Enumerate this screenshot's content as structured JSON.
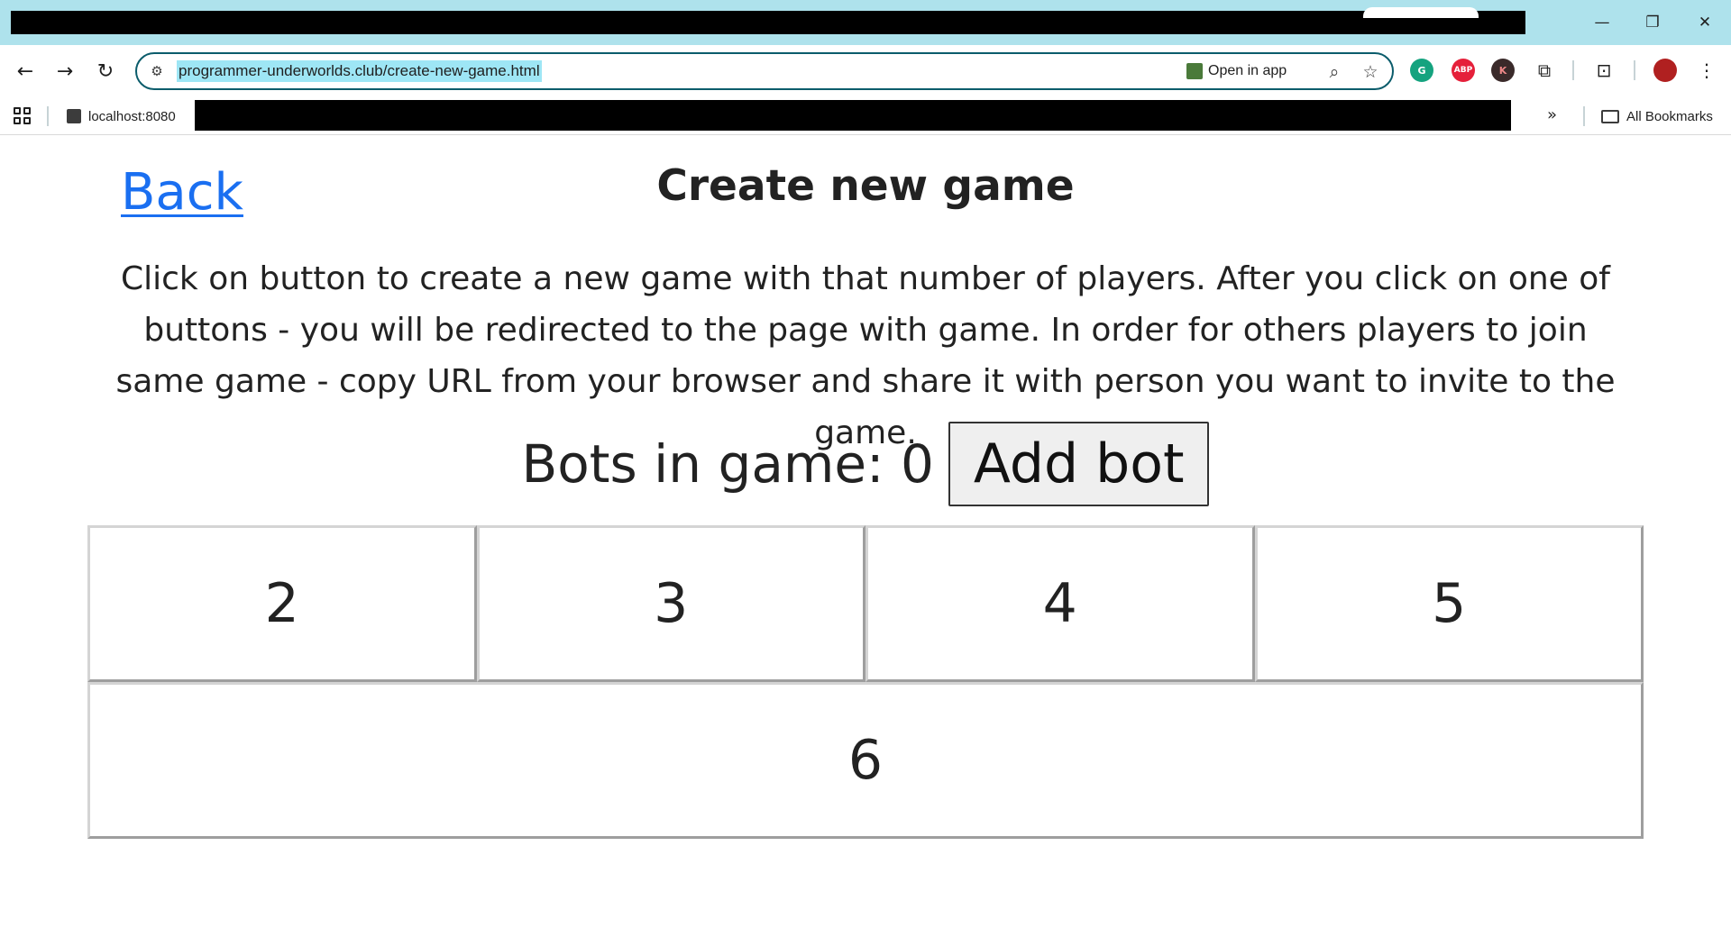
{
  "browser": {
    "url": "programmer-underworlds.club/create-new-game.html",
    "open_in_app": "Open in app",
    "window_minimize": "—",
    "window_restore": "❐",
    "window_close": "✕",
    "nav_back": "←",
    "nav_forward": "→",
    "nav_reload": "↻",
    "zoom_icon": "⌕",
    "star_icon": "☆",
    "ext_grammarly": "G",
    "ext_abp": "ABP",
    "ext_k": "K",
    "bookmarks": {
      "localhost": "localhost:8080",
      "more": "»",
      "all": "All Bookmarks"
    }
  },
  "page": {
    "back_label": "Back",
    "title": "Create new game",
    "instructions": "Click on button to create a new game with that number of players. After you click on one of buttons - you will be redirected to the page with game. In order for others players to join same game - copy URL from your browser and share it with person you want to invite to the game.",
    "bots_label": "Bots in game: 0",
    "add_bot_label": "Add bot",
    "player_counts": [
      "2",
      "3",
      "4",
      "5",
      "6"
    ]
  }
}
